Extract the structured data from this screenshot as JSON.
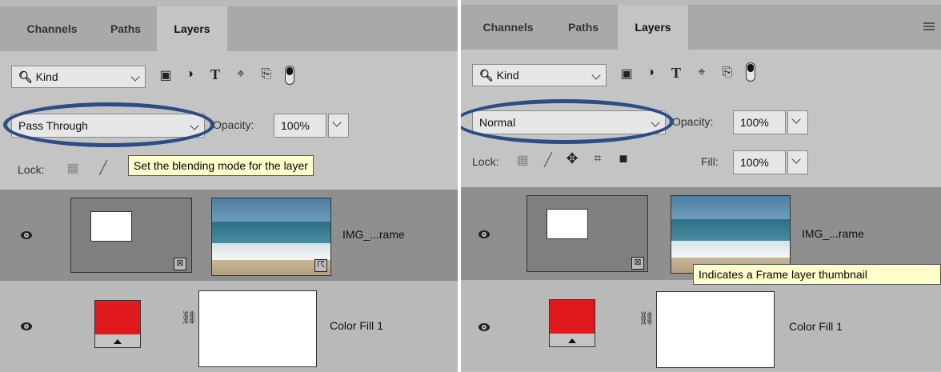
{
  "left_panel": {
    "tabs": [
      {
        "label": "Channels",
        "active": false
      },
      {
        "label": "Paths",
        "active": false
      },
      {
        "label": "Layers",
        "active": true
      }
    ],
    "filter": {
      "label": "Kind",
      "icons": [
        "image-icon",
        "adjustment-icon",
        "type-icon",
        "shape-icon",
        "smart-object-icon"
      ]
    },
    "blend_mode": "Pass Through",
    "opacity_label": "Opacity:",
    "opacity_value": "100%",
    "lock_label": "Lock:",
    "tooltip": "Set the blending mode for the layer",
    "layers": [
      {
        "name": "IMG_...rame",
        "type": "frame",
        "selected": true
      },
      {
        "name": "Color Fill 1",
        "type": "color-fill",
        "selected": false,
        "fill_color": "#e2191c"
      }
    ]
  },
  "right_panel": {
    "tabs": [
      {
        "label": "Channels",
        "active": false
      },
      {
        "label": "Paths",
        "active": false
      },
      {
        "label": "Layers",
        "active": true
      }
    ],
    "filter": {
      "label": "Kind"
    },
    "blend_mode": "Normal",
    "opacity_label": "Opacity:",
    "opacity_value": "100%",
    "lock_label": "Lock:",
    "fill_label": "Fill:",
    "fill_value": "100%",
    "tooltip": "Indicates a Frame layer thumbnail",
    "layers": [
      {
        "name": "IMG_...rame",
        "type": "frame",
        "selected": true
      },
      {
        "name": "Color Fill 1",
        "type": "color-fill",
        "selected": false,
        "fill_color": "#e2191c"
      }
    ]
  },
  "colors": {
    "annotation_ellipse": "#2d4c86",
    "tooltip_bg": "#ffffcc",
    "selected_row": "#8f8f8f"
  }
}
